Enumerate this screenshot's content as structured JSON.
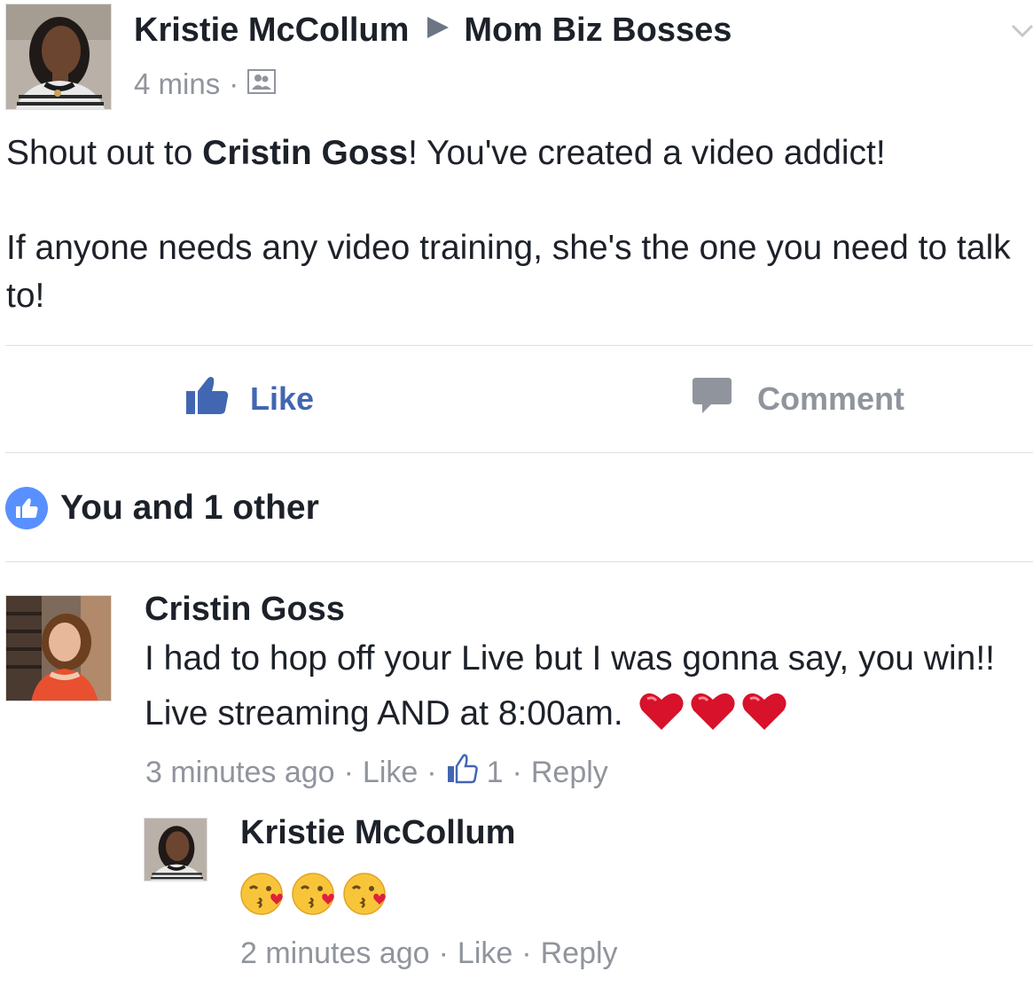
{
  "post": {
    "author": "Kristie McCollum",
    "group": "Mom Biz Bosses",
    "time": "4 mins",
    "audience_icon": "group-audience-icon",
    "menu_icon": "chevron-down-icon",
    "body_pre": "Shout out to ",
    "body_mention": "Cristin Goss",
    "body_post": "!  You've created a video addict!",
    "body_para2": "If anyone needs any video training, she's the one you need to talk to!"
  },
  "actions": {
    "like_label": "Like",
    "comment_label": "Comment",
    "like_icon": "thumbs-up-icon",
    "comment_icon": "speech-bubble-icon"
  },
  "reactions": {
    "summary": "You and 1 other",
    "icon": "like-reaction-icon"
  },
  "comments": [
    {
      "author": "Cristin Goss",
      "text": "I had to hop off your Live but I was gonna say, you win!! Live streaming AND at 8:00am.",
      "emoji": [
        "heart",
        "heart",
        "heart"
      ],
      "time": "3 minutes ago",
      "like_label": "Like",
      "like_count": "1",
      "reply_label": "Reply"
    },
    {
      "author": "Kristie McCollum",
      "emoji": [
        "face-blowing-kiss",
        "face-blowing-kiss",
        "face-blowing-kiss"
      ],
      "time": "2 minutes ago",
      "like_label": "Like",
      "reply_label": "Reply"
    }
  ],
  "colors": {
    "fb_blue": "#4267b2",
    "reaction_blue": "#5890ff",
    "meta_gray": "#90949c",
    "text": "#1d2129",
    "divider": "#dddfe2"
  }
}
